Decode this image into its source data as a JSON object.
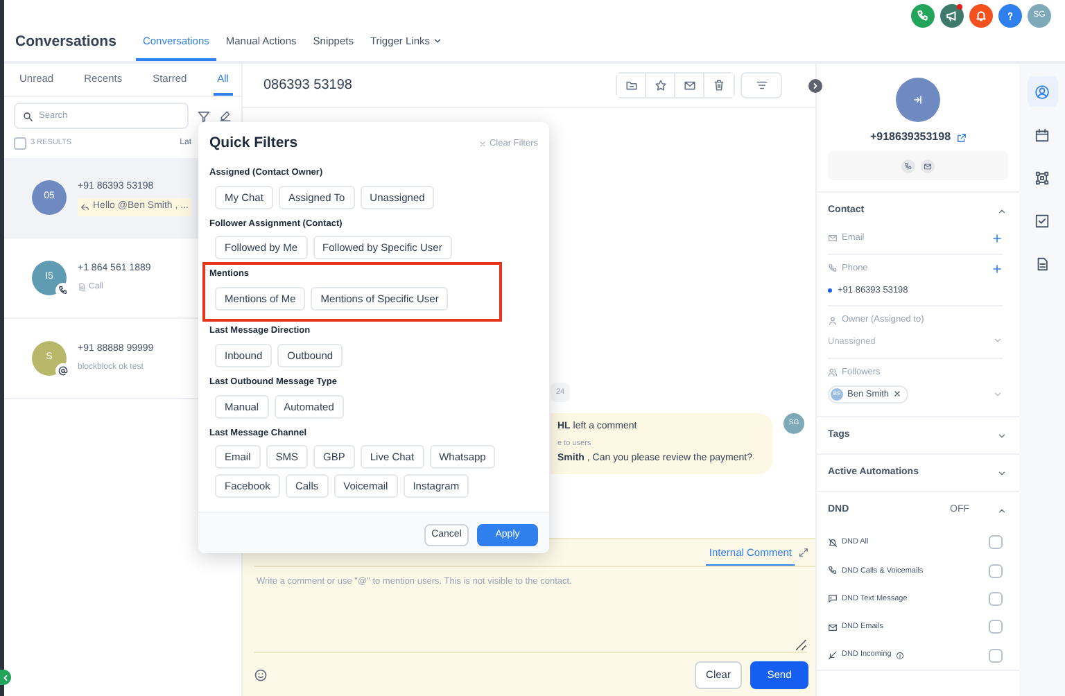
{
  "topbar": {
    "title": "Conversations",
    "nav": [
      {
        "label": "Conversations",
        "selected": true
      },
      {
        "label": "Manual Actions",
        "selected": false
      },
      {
        "label": "Snippets",
        "selected": false
      },
      {
        "label": "Trigger Links",
        "selected": false,
        "dropdown": true
      }
    ],
    "actions": [
      {
        "kind": "phone",
        "color": "#22a55b",
        "dot": false
      },
      {
        "kind": "megaphone",
        "color": "#3f7b6b",
        "dot": true
      },
      {
        "kind": "bell",
        "color": "#f4511e",
        "dot": false
      },
      {
        "kind": "help",
        "color": "#2f7fed",
        "dot": false
      }
    ],
    "user": {
      "initials": "SG"
    }
  },
  "inbox": {
    "tabs": [
      {
        "label": "Unread",
        "selected": false
      },
      {
        "label": "Recents",
        "selected": false
      },
      {
        "label": "Starred",
        "selected": false
      },
      {
        "label": "All",
        "selected": true
      }
    ],
    "search": {
      "placeholder": "Search"
    },
    "select_all": {
      "checked": false
    },
    "results": "3 RESULTS",
    "sort": "Lat",
    "conversations": [
      {
        "initials": "05",
        "color": "#6f8ac0",
        "name": "+91 86393 53198",
        "preview": "Hello @Ben Smith , ...",
        "kind": "reply",
        "selected": true
      },
      {
        "initials": "I5",
        "color": "#5f9cb3",
        "name": "+1 864 561 1889",
        "preview": "Call",
        "kind": "call",
        "selected": false
      },
      {
        "initials": "S",
        "color": "#b8b86a",
        "name": "+91 88888 99999",
        "preview": "blockblock ok test",
        "kind": "mention",
        "selected": false
      }
    ]
  },
  "conversation": {
    "title": "086393 53198",
    "date": "24",
    "comment": {
      "author": "HL",
      "action": "left a comment",
      "note": "e to users",
      "body": "**Smith** , Can you please review the payment?",
      "avatar": "SG"
    },
    "composer": {
      "tab": "Internal Comment",
      "placeholder": "Write a comment or use \"@\" to mention users. This is not visible to the contact.",
      "buttons": [
        {
          "label": "Clear",
          "kind": "secondary"
        },
        {
          "label": "Send",
          "kind": "primary"
        }
      ]
    }
  },
  "quick_filters": {
    "title": "Quick Filters",
    "clear": "Clear Filters",
    "groups": [
      {
        "title": "Assigned (Contact Owner)",
        "highlighted": false,
        "options": [
          "My Chat",
          "Assigned To",
          "Unassigned"
        ]
      },
      {
        "title": "Follower Assignment (Contact)",
        "highlighted": false,
        "options": [
          "Followed by Me",
          "Followed by Specific User"
        ]
      },
      {
        "title": "Mentions",
        "highlighted": true,
        "options": [
          "Mentions of Me",
          "Mentions of Specific User"
        ]
      },
      {
        "title": "Last Message Direction",
        "highlighted": false,
        "options": [
          "Inbound",
          "Outbound"
        ]
      },
      {
        "title": "Last Outbound Message Type",
        "highlighted": false,
        "options": [
          "Manual",
          "Automated"
        ]
      },
      {
        "title": "Last Message Channel",
        "highlighted": false,
        "options": [
          "Email",
          "SMS",
          "GBP",
          "Live Chat",
          "Whatsapp",
          "Facebook",
          "Calls",
          "Voicemail",
          "Instagram"
        ]
      }
    ],
    "buttons": [
      {
        "label": "Cancel",
        "kind": "secondary"
      },
      {
        "label": "Apply",
        "kind": "primary"
      }
    ]
  },
  "contact": {
    "phone": "+918639353198",
    "sections": [
      {
        "title": "Contact",
        "expanded": true,
        "fields": [
          {
            "kind": "email",
            "label": "Email",
            "add": true
          },
          {
            "kind": "phone",
            "label": "Phone",
            "add": true,
            "values": [
              "+91 86393 53198"
            ]
          },
          {
            "kind": "owner",
            "label": "Owner (Assigned to)",
            "select": "Unassigned"
          },
          {
            "kind": "followers",
            "label": "Followers",
            "chips": [
              {
                "initials": "BS",
                "name": "Ben Smith"
              }
            ]
          }
        ]
      },
      {
        "title": "Tags",
        "expanded": false
      },
      {
        "title": "Active Automations",
        "expanded": false
      },
      {
        "title": "DND",
        "expanded": true,
        "status": "OFF",
        "items": [
          {
            "kind": "all",
            "label": "DND All",
            "checked": false
          },
          {
            "kind": "calls",
            "label": "DND Calls & Voicemails",
            "checked": false
          },
          {
            "kind": "text",
            "label": "DND Text Message",
            "checked": false
          },
          {
            "kind": "emails",
            "label": "DND Emails",
            "checked": false
          },
          {
            "kind": "incoming",
            "label": "DND Incoming",
            "checked": false,
            "info": true
          }
        ]
      }
    ]
  },
  "rail": [
    {
      "kind": "contact",
      "selected": true
    },
    {
      "kind": "calendar",
      "selected": false
    },
    {
      "kind": "nodes",
      "selected": false
    },
    {
      "kind": "tasks",
      "selected": false
    },
    {
      "kind": "document",
      "selected": false
    }
  ]
}
